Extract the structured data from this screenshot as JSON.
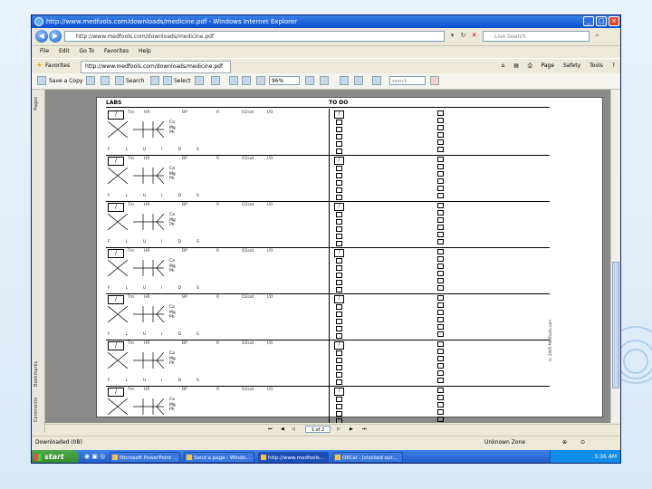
{
  "window": {
    "title": "http://www.medfools.com/downloads/medicine.pdf - Windows Internet Explorer"
  },
  "address_bar": {
    "url": "http://www.medfools.com/downloads/medicine.pdf",
    "search_placeholder": "Live Search"
  },
  "menu": [
    "File",
    "Edit",
    "Go To",
    "Favorites",
    "Help"
  ],
  "favorites_bar": {
    "favorites_label": "Favorites",
    "tab_url": "http://www.medfools.com/downloads/medicine.pdf",
    "right_tools": [
      "Page",
      "Safety",
      "Tools"
    ]
  },
  "pdf_toolbar": {
    "save_copy": "Save a Copy",
    "search": "Search",
    "select": "Select",
    "zoom": "96%",
    "find_placeholder": "search"
  },
  "left_panel": {
    "tabs": [
      "Pages",
      "Bookmarks",
      "Comments"
    ]
  },
  "document": {
    "labs_heading": "LABS",
    "todo_heading": "TO DO",
    "patient_box": "/",
    "vitals": [
      "Tm",
      "HR",
      "BP",
      "R",
      "O2sat",
      "I/O"
    ],
    "electrolytes": [
      "Ca",
      "Mg",
      "Ph"
    ],
    "fluids": "F L U I D S",
    "row_count": 7,
    "copyright": "© 2005 MedFools.com"
  },
  "page_nav": {
    "page_indicator": "1 of 2"
  },
  "status_bar": {
    "left": "Downloaded (0B)",
    "zone": "Unknown Zone"
  },
  "taskbar": {
    "start": "start",
    "buttons": [
      "Microsoft PowerPoint ...",
      "Send a page - Windo...",
      "http://www.medfools...",
      "OKCal - [clocked out..."
    ],
    "clock": "5:36 AM"
  }
}
